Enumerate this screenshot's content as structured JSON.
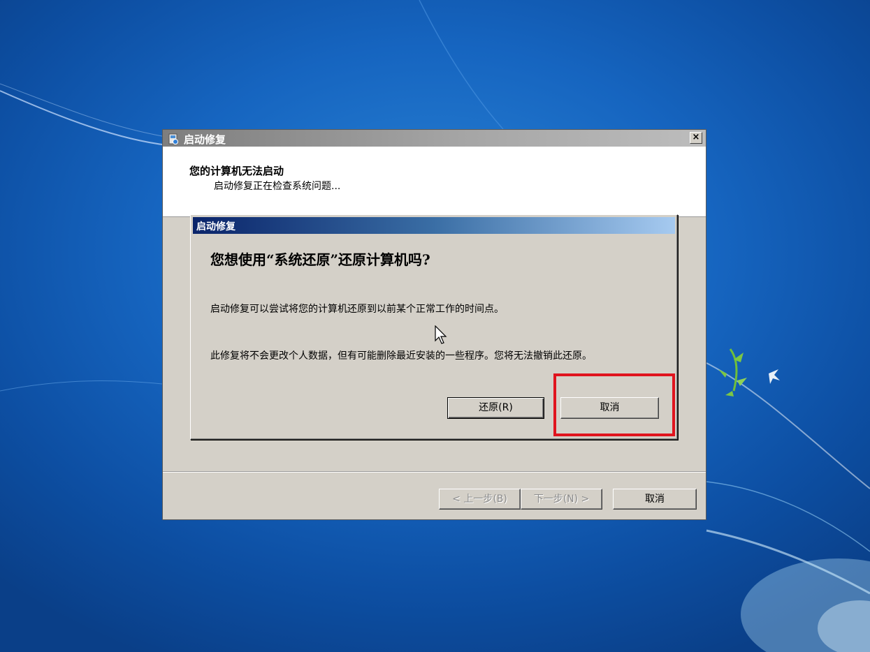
{
  "wizard": {
    "title": "启动修复",
    "heading": "您的计算机无法启动",
    "subheading": "启动修复正在检查系统问题...",
    "close_label": "×",
    "back_label": "< 上一步(B)",
    "next_label": "下一步(N) >",
    "cancel_label": "取消"
  },
  "dialog": {
    "title": "启动修复",
    "question": "您想使用“系统还原”还原计算机吗?",
    "text1": "启动修复可以尝试将您的计算机还原到以前某个正常工作的时间点。",
    "text2": "此修复将不会更改个人数据，但有可能删除最近安装的一些程序。您将无法撤销此还原。",
    "restore_label": "还原(R)",
    "cancel_label": "取消"
  },
  "colors": {
    "highlight": "#e0141e",
    "dialog_titlebar_start": "#0a246a",
    "dialog_titlebar_end": "#a6caf0",
    "window_face": "#d4d0c8"
  },
  "icons": {
    "app": "startup-repair-icon",
    "close": "close-icon",
    "cursor": "mouse-pointer-icon"
  }
}
